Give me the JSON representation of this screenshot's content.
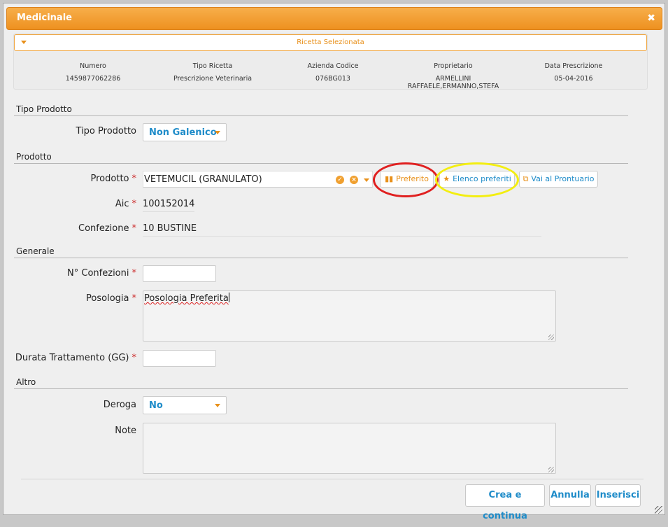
{
  "window": {
    "title": "Medicinale",
    "close_glyph": "✖"
  },
  "recipe": {
    "header": "Ricetta Selezionata",
    "columns": [
      {
        "label": "Numero",
        "value": "1459877062286"
      },
      {
        "label": "Tipo Ricetta",
        "value": "Prescrizione Veterinaria"
      },
      {
        "label": "Azienda Codice",
        "value": "076BG013"
      },
      {
        "label": "Proprietario",
        "value": "ARMELLINI RAFFAELE,ERMANNO,STEFA"
      },
      {
        "label": "Data Prescrizione",
        "value": "05-04-2016"
      }
    ]
  },
  "sections": {
    "tipo_prodotto": "Tipo Prodotto",
    "prodotto": "Prodotto",
    "generale": "Generale",
    "altro": "Altro"
  },
  "fields": {
    "tipo_prodotto": {
      "label": "Tipo Prodotto",
      "value": "Non Galenico"
    },
    "prodotto": {
      "label": "Prodotto",
      "value": "VETEMUCIL (GRANULATO)"
    },
    "aic": {
      "label": "Aic",
      "value": "100152014"
    },
    "confezione": {
      "label": "Confezione",
      "value": "10 BUSTINE"
    },
    "n_confezioni": {
      "label": "N° Confezioni",
      "value": ""
    },
    "posologia": {
      "label": "Posologia",
      "value": "Posologia Preferita"
    },
    "durata": {
      "label": "Durata Trattamento (GG)",
      "value": ""
    },
    "deroga": {
      "label": "Deroga",
      "value": "No"
    },
    "note": {
      "label": "Note",
      "value": ""
    }
  },
  "required_mark": "*",
  "product_buttons": {
    "preferito": "Preferito",
    "elenco_preferiti": "Elenco preferiti",
    "vai_prontuario": "Vai al Prontuario"
  },
  "footer": {
    "crea_continua": "Crea e continua",
    "annulla": "Annulla",
    "inserisci": "Inserisci"
  },
  "colors": {
    "accent": "#ee9120",
    "link_blue": "#1f8cc9",
    "required": "#cc2a2a",
    "highlight_red": "#e02020",
    "highlight_yellow": "#f3ee10"
  },
  "icons": {
    "preferito": "bookmark-icon",
    "elenco_preferiti": "star-icon",
    "vai_prontuario": "external-link-icon",
    "confirm": "check-circle-icon",
    "clear": "clear-circle-icon"
  }
}
